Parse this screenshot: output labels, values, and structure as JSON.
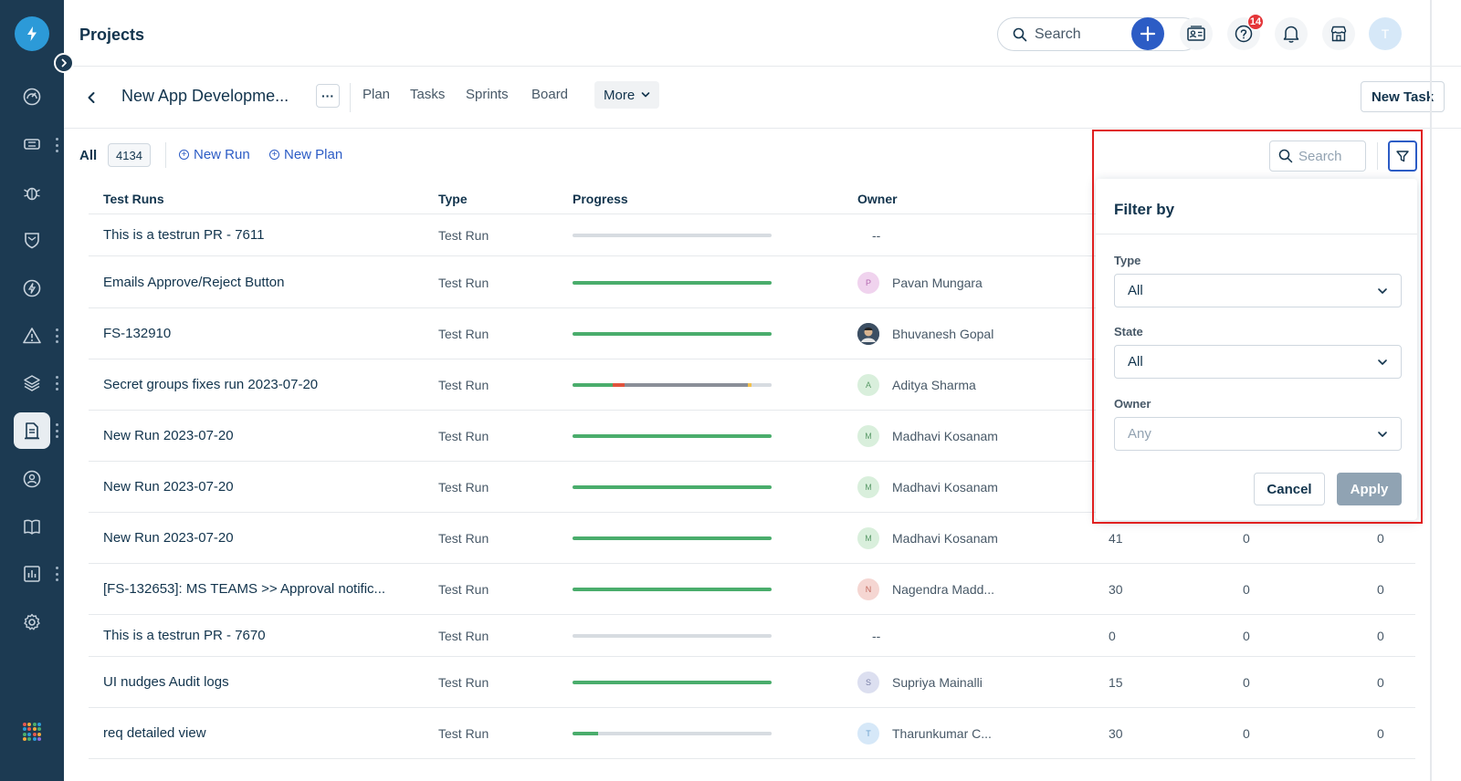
{
  "app": {
    "page_title": "Projects",
    "search_placeholder": "Search",
    "notification_count": "14",
    "user_initial": "T"
  },
  "project": {
    "name": "New App Developme...",
    "more_dots": "···",
    "tabs": [
      "Plan",
      "Tasks",
      "Sprints",
      "Board"
    ],
    "more_label": "More",
    "new_task_label": "New Task"
  },
  "toolbar": {
    "all_label": "All",
    "all_count": "4134",
    "new_run_label": "New Run",
    "new_plan_label": "New Plan",
    "search_placeholder": "Search"
  },
  "table": {
    "headers": [
      "Test Runs",
      "Type",
      "Progress",
      "Owner"
    ],
    "rows": [
      {
        "name": "This is a testrun PR - 7611",
        "type": "Test Run",
        "progress": [
          {
            "color": "#d7dce1",
            "pct": 100
          }
        ],
        "owner": "--",
        "avatar": "",
        "av_bg": "",
        "av_fg": "",
        "n1": "",
        "n2": "",
        "n3": ""
      },
      {
        "name": "Emails Approve/Reject Button",
        "type": "Test Run",
        "progress": [
          {
            "color": "#4aad6c",
            "pct": 100
          }
        ],
        "owner": "Pavan Mungara",
        "avatar": "P",
        "av_bg": "#f0d3ee",
        "av_fg": "#b46ab1",
        "n1": "",
        "n2": "",
        "n3": ""
      },
      {
        "name": "FS-132910",
        "type": "Test Run",
        "progress": [
          {
            "color": "#4aad6c",
            "pct": 100
          }
        ],
        "owner": "Bhuvanesh Gopal",
        "avatar": "photo",
        "av_bg": "#3c4f63",
        "av_fg": "#ffffff",
        "n1": "",
        "n2": "",
        "n3": ""
      },
      {
        "name": "Secret groups fixes run 2023-07-20",
        "type": "Test Run",
        "progress": [
          {
            "color": "#4aad6c",
            "pct": 20
          },
          {
            "color": "#e0533d",
            "pct": 6
          },
          {
            "color": "#8a8f98",
            "pct": 62
          },
          {
            "color": "#f2c14e",
            "pct": 2
          },
          {
            "color": "#d7dce1",
            "pct": 10
          }
        ],
        "owner": "Aditya Sharma",
        "avatar": "A",
        "av_bg": "#d9efdc",
        "av_fg": "#5a9a68",
        "n1": "",
        "n2": "",
        "n3": ""
      },
      {
        "name": "New Run 2023-07-20",
        "type": "Test Run",
        "progress": [
          {
            "color": "#4aad6c",
            "pct": 100
          }
        ],
        "owner": "Madhavi Kosanam",
        "avatar": "M",
        "av_bg": "#d9efdc",
        "av_fg": "#5a9a68",
        "n1": "",
        "n2": "",
        "n3": ""
      },
      {
        "name": "New Run 2023-07-20",
        "type": "Test Run",
        "progress": [
          {
            "color": "#4aad6c",
            "pct": 100
          }
        ],
        "owner": "Madhavi Kosanam",
        "avatar": "M",
        "av_bg": "#d9efdc",
        "av_fg": "#5a9a68",
        "n1": "",
        "n2": "",
        "n3": ""
      },
      {
        "name": "New Run 2023-07-20",
        "type": "Test Run",
        "progress": [
          {
            "color": "#4aad6c",
            "pct": 100
          }
        ],
        "owner": "Madhavi Kosanam",
        "avatar": "M",
        "av_bg": "#d9efdc",
        "av_fg": "#5a9a68",
        "n1": "41",
        "n2": "0",
        "n3": "0"
      },
      {
        "name": "[FS-132653]: MS TEAMS >> Approval notific...",
        "type": "Test Run",
        "progress": [
          {
            "color": "#4aad6c",
            "pct": 100
          }
        ],
        "owner": "Nagendra Madd...",
        "avatar": "N",
        "av_bg": "#f5d6d2",
        "av_fg": "#c2685d",
        "n1": "30",
        "n2": "0",
        "n3": "0"
      },
      {
        "name": "This is a testrun PR - 7670",
        "type": "Test Run",
        "progress": [
          {
            "color": "#d7dce1",
            "pct": 100
          }
        ],
        "owner": "--",
        "avatar": "",
        "av_bg": "",
        "av_fg": "",
        "n1": "0",
        "n2": "0",
        "n3": "0"
      },
      {
        "name": "UI nudges Audit logs",
        "type": "Test Run",
        "progress": [
          {
            "color": "#4aad6c",
            "pct": 100
          }
        ],
        "owner": "Supriya Mainalli",
        "avatar": "S",
        "av_bg": "#dcdff0",
        "av_fg": "#7b80a8",
        "n1": "15",
        "n2": "0",
        "n3": "0"
      },
      {
        "name": "req detailed view",
        "type": "Test Run",
        "progress": [
          {
            "color": "#4aad6c",
            "pct": 13
          },
          {
            "color": "#d7dce1",
            "pct": 87
          }
        ],
        "owner": "Tharunkumar C...",
        "avatar": "T",
        "av_bg": "#d6e8f8",
        "av_fg": "#6a9fcc",
        "n1": "30",
        "n2": "0",
        "n3": "0"
      }
    ]
  },
  "filter": {
    "title": "Filter by",
    "type_label": "Type",
    "type_value": "All",
    "state_label": "State",
    "state_value": "All",
    "owner_label": "Owner",
    "owner_value": "Any",
    "cancel_label": "Cancel",
    "apply_label": "Apply"
  },
  "colors": {
    "sidebar_bg": "#1c3a52",
    "accent": "#2c5cc5",
    "progress_green": "#4aad6c",
    "highlight_red": "#e02020"
  },
  "icons": {
    "sidebar": [
      "dashboard-icon",
      "tickets-icon",
      "bug-icon",
      "shield-icon",
      "lightning-icon",
      "alert-icon",
      "layers-icon",
      "testcase-icon",
      "release-icon",
      "book-icon",
      "chart-icon",
      "settings-icon"
    ]
  }
}
